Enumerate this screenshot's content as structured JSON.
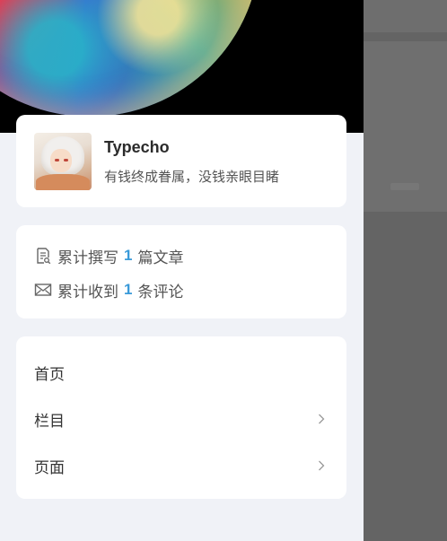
{
  "profile": {
    "name": "Typecho",
    "motto": "有钱终成眷属，没钱亲眼目睹"
  },
  "stats": {
    "posts": {
      "prefix": "累计撰写",
      "count": "1",
      "suffix": "篇文章"
    },
    "comments": {
      "prefix": "累计收到",
      "count": "1",
      "suffix": "条评论"
    }
  },
  "menu": [
    {
      "label": "首页",
      "has_submenu": false
    },
    {
      "label": "栏目",
      "has_submenu": true
    },
    {
      "label": "页面",
      "has_submenu": true
    }
  ],
  "colors": {
    "accent": "#3a9ad9",
    "drawer_bg": "#f0f2f7",
    "overlay": "#646464"
  }
}
